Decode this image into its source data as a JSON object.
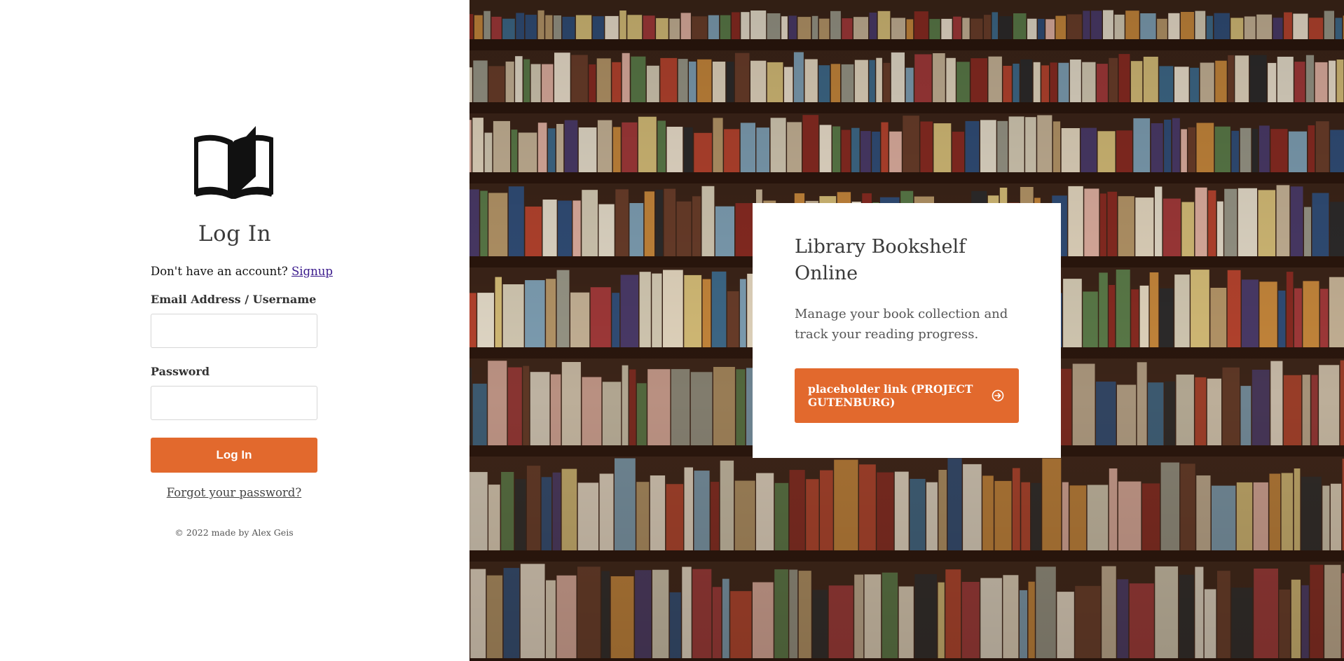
{
  "login": {
    "title": "Log In",
    "signup_prompt": "Don't have an account?",
    "signup_link": "Signup",
    "email_label": "Email Address / Username",
    "email_value": "",
    "password_label": "Password",
    "password_value": "",
    "submit_label": "Log In",
    "forgot_link": "Forgot your password?",
    "footer": "© 2022 made by Alex Geis"
  },
  "icons": {
    "logo": "open-book-icon",
    "card_link": "arrow-right-circle-icon"
  },
  "hero": {
    "background": "bookshelf-photo",
    "card": {
      "title": "Library Bookshelf Online",
      "description": "Manage your book collection and track your reading progress.",
      "link_label": "placeholder link (PROJECT GUTENBURG)"
    }
  },
  "colors": {
    "accent": "#e2692d",
    "link": "#3a1a8c",
    "text": "#333333"
  }
}
